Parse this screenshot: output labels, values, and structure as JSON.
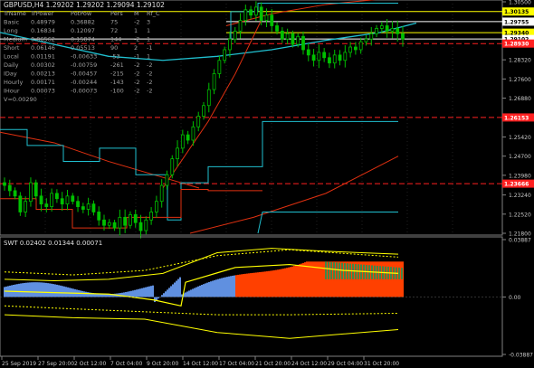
{
  "window": {
    "symbol_line": "GBPUSD,H4  1.29202 1.29202 1.29094 1.29102"
  },
  "trend_table": {
    "header": [
      "TrName",
      "TrPower",
      "PotPow",
      "Pers",
      "M",
      "Rf_C"
    ],
    "rows": [
      [
        "Basic",
        "0.48979",
        "0.36882",
        "75",
        "-2",
        "3"
      ],
      [
        "Long",
        "0.16834",
        "0.12097",
        "72",
        "1",
        "1"
      ],
      [
        "Medium",
        "0.06562",
        "0.15874",
        "144",
        "-2",
        "1"
      ],
      [
        "Short",
        "0.06146",
        "0.05513",
        "90",
        "2",
        "-1"
      ],
      [
        "Local",
        "0.01191",
        "-0.00633",
        "-53",
        "-1",
        "1"
      ],
      [
        "Daily",
        "0.00302",
        "-0.00759",
        "-261",
        "-2",
        "-2"
      ],
      [
        "IDay",
        "0.00213",
        "-0.00457",
        "-215",
        "-2",
        "-2"
      ],
      [
        "Hourly",
        "0.00171",
        "-0.00244",
        "-143",
        "-2",
        "-2"
      ],
      [
        "IHour",
        "0.00073",
        "-0.00073",
        "-100",
        "-2",
        "-2"
      ]
    ],
    "footer": "V=0.00290"
  },
  "price_axis": {
    "labels": [
      "1.30500",
      "1.29760",
      "1.29340",
      "1.29102",
      "1.28320",
      "1.27600",
      "1.26880",
      "1.26160",
      "1.25420",
      "1.24700",
      "1.23980",
      "1.23660",
      "1.23240",
      "1.22520",
      "1.21800"
    ],
    "tags": [
      {
        "label": "1.30135",
        "bg": "#ffff00",
        "fg": "#000000"
      },
      {
        "label": "1.29755",
        "bg": "#ffffff",
        "fg": "#000000"
      },
      {
        "label": "1.29340",
        "bg": "#ffff00",
        "fg": "#000000"
      },
      {
        "label": "1.29102",
        "bg": "#ffffff",
        "fg": "#000000"
      },
      {
        "label": "1.28930",
        "bg": "#ff2020",
        "fg": "#ffffff"
      },
      {
        "label": "1.26153",
        "bg": "#ff2020",
        "fg": "#ffffff"
      },
      {
        "label": "1.23666",
        "bg": "#ff2020",
        "fg": "#ffffff"
      }
    ]
  },
  "indicator": {
    "title": "SWT 0.02402 0.01344 0.00071",
    "axis_labels": [
      "0.03887",
      "0.00",
      "-0.03887"
    ]
  },
  "time_axis": {
    "labels": [
      "25 Sep 2019",
      "27 Sep 20:00",
      "2 Oct 12:00",
      "7 Oct 04:00",
      "9 Oct 20:00",
      "14 Oct 12:00",
      "17 Oct 04:00",
      "21 Oct 20:00",
      "24 Oct 12:00",
      "29 Oct 04:00",
      "31 Oct 20:00"
    ]
  },
  "chart_data": {
    "type": "candlestick",
    "symbol": "GBPUSD",
    "timeframe": "H4",
    "last_bar": {
      "open": 1.29202,
      "high": 1.29202,
      "low": 1.29094,
      "close": 1.29102
    },
    "ylim": [
      1.218,
      1.305
    ],
    "indicator_ylim": [
      -0.03887,
      0.03887
    ],
    "levels": {
      "resistance_yellow": 1.30135,
      "white_line": 1.29755,
      "yellow_line": 1.2934,
      "current": 1.29102,
      "red_dashed_1": 1.2893,
      "red_dashed_2": 1.26153,
      "red_dashed_3": 1.23666
    },
    "close_path": [
      1.236,
      1.234,
      1.232,
      1.226,
      1.23,
      1.237,
      1.232,
      1.229,
      1.228,
      1.233,
      1.231,
      1.229,
      1.232,
      1.23,
      1.228,
      1.227,
      1.229,
      1.226,
      1.223,
      1.221,
      1.222,
      1.22,
      1.224,
      1.221,
      1.225,
      1.222,
      1.219,
      1.223,
      1.226,
      1.23,
      1.236,
      1.24,
      1.246,
      1.25,
      1.255,
      1.253,
      1.258,
      1.262,
      1.266,
      1.272,
      1.278,
      1.283,
      1.287,
      1.291,
      1.294,
      1.298,
      1.302,
      1.3,
      1.303,
      1.298,
      1.3,
      1.296,
      1.294,
      1.291,
      1.293,
      1.289,
      1.292,
      1.287,
      1.285,
      1.283,
      1.286,
      1.284,
      1.282,
      1.285,
      1.283,
      1.286,
      1.288,
      1.287,
      1.29,
      1.291,
      1.293,
      1.295,
      1.296,
      1.294,
      1.295,
      1.293,
      1.291
    ]
  },
  "colors": {
    "background": "#000000",
    "grid": "#404040",
    "bull_candle": "#00c000",
    "bear_candle": "#00c000",
    "ma_cyan": "#20c0d0",
    "ma_red": "#e03010",
    "hist_orange": "#ff4000",
    "hist_blue": "#6090e0",
    "hist_green": "#00a060",
    "line_yellow": "#ffff00"
  }
}
